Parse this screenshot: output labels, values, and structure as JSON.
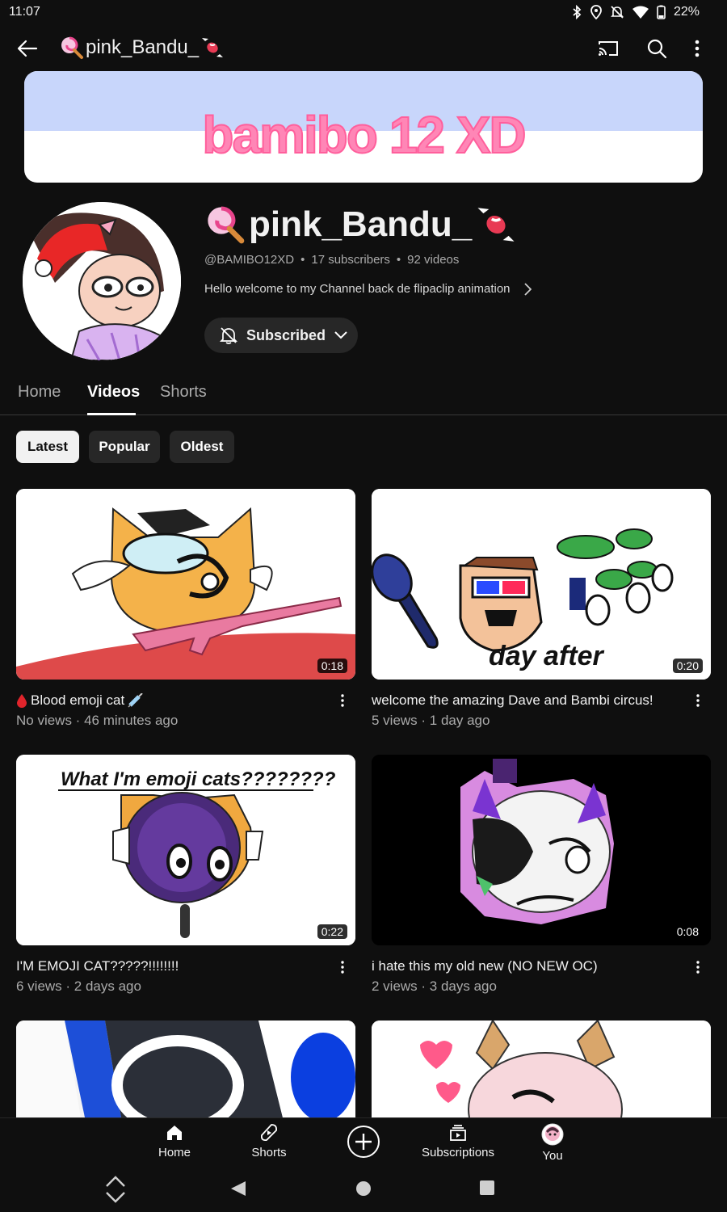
{
  "status": {
    "time": "11:07",
    "battery": "22%"
  },
  "app_bar": {
    "title": "pink_Bandu_"
  },
  "banner": {
    "text": "bamibo 12 XD"
  },
  "channel": {
    "name": "pink_Bandu_",
    "handle": "@BAMIBO12XD",
    "subscribers": "17 subscribers",
    "videos": "92 videos",
    "description": "Hello welcome to my Channel back de flipaclip animation",
    "subscribe_label": "Subscribed"
  },
  "tabs": [
    {
      "label": "Home"
    },
    {
      "label": "Videos"
    },
    {
      "label": "Shorts"
    }
  ],
  "chips": [
    {
      "label": "Latest"
    },
    {
      "label": "Popular"
    },
    {
      "label": "Oldest"
    }
  ],
  "videos": [
    {
      "title": "Blood emoji cat",
      "meta": "No views · 46 minutes ago",
      "duration": "0:18"
    },
    {
      "title": "welcome the amazing Dave and Bambi circus!",
      "meta": "5 views · 1 day ago",
      "duration": "0:20",
      "thumb_text": "day after"
    },
    {
      "title": "I'M EMOJI CAT?????!!!!!!!!",
      "meta": "6 views · 2 days ago",
      "duration": "0:22",
      "thumb_text": "What I'm emoji cats????????"
    },
    {
      "title": "i hate this my old new (NO NEW OC)",
      "meta": "2 views · 3 days ago",
      "duration": "0:08"
    }
  ],
  "bottom_nav": [
    {
      "label": "Home"
    },
    {
      "label": "Shorts"
    },
    {
      "label": "Subscriptions"
    },
    {
      "label": "You"
    }
  ],
  "colors": {
    "background": "#0f0f0f",
    "chip": "#272727",
    "banner_sky": "#c8d6fb",
    "banner_text": "#ff86b6"
  }
}
